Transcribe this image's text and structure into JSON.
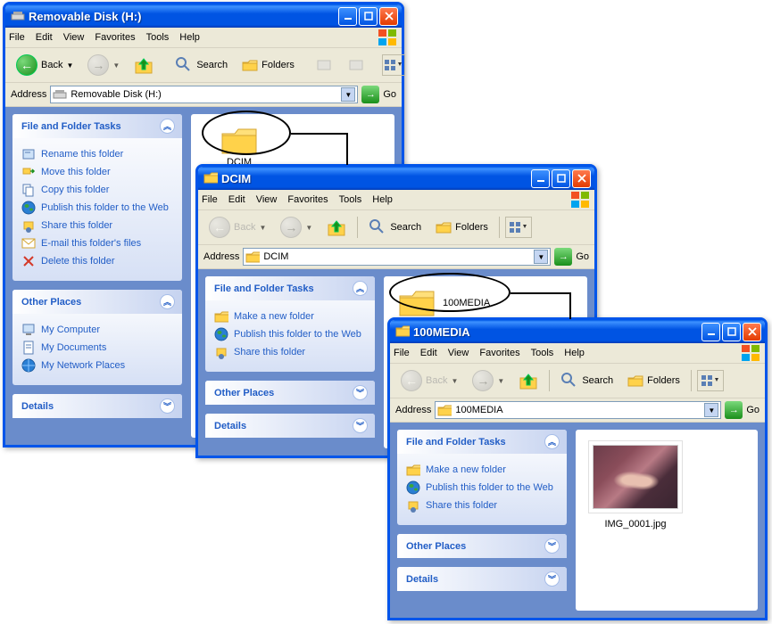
{
  "windows": {
    "w1": {
      "title": "Removable Disk (H:)",
      "menu": {
        "file": "File",
        "edit": "Edit",
        "view": "View",
        "favorites": "Favorites",
        "tools": "Tools",
        "help": "Help"
      },
      "toolbar": {
        "back": "Back",
        "search": "Search",
        "folders": "Folders"
      },
      "address_label": "Address",
      "address_value": "Removable Disk (H:)",
      "go": "Go",
      "sidebar": {
        "tasks_title": "File and Folder Tasks",
        "tasks": [
          {
            "label": "Rename this folder"
          },
          {
            "label": "Move this folder"
          },
          {
            "label": "Copy this folder"
          },
          {
            "label": "Publish this folder to the Web"
          },
          {
            "label": "Share this folder"
          },
          {
            "label": "E-mail this folder's files"
          },
          {
            "label": "Delete this folder"
          }
        ],
        "other_title": "Other Places",
        "other": [
          {
            "label": "My Computer"
          },
          {
            "label": "My Documents"
          },
          {
            "label": "My Network Places"
          }
        ],
        "details_title": "Details"
      },
      "content": {
        "folder_name": "DCIM"
      }
    },
    "w2": {
      "title": "DCIM",
      "menu": {
        "file": "File",
        "edit": "Edit",
        "view": "View",
        "favorites": "Favorites",
        "tools": "Tools",
        "help": "Help"
      },
      "toolbar": {
        "back": "Back",
        "search": "Search",
        "folders": "Folders"
      },
      "address_label": "Address",
      "address_value": "DCIM",
      "go": "Go",
      "sidebar": {
        "tasks_title": "File and Folder Tasks",
        "tasks": [
          {
            "label": "Make a new folder"
          },
          {
            "label": "Publish this folder to the Web"
          },
          {
            "label": "Share this folder"
          }
        ],
        "other_title": "Other Places",
        "details_title": "Details"
      },
      "content": {
        "folder_name": "100MEDIA"
      }
    },
    "w3": {
      "title": "100MEDIA",
      "menu": {
        "file": "File",
        "edit": "Edit",
        "view": "View",
        "favorites": "Favorites",
        "tools": "Tools",
        "help": "Help"
      },
      "toolbar": {
        "back": "Back",
        "search": "Search",
        "folders": "Folders"
      },
      "address_label": "Address",
      "address_value": "100MEDIA",
      "go": "Go",
      "sidebar": {
        "tasks_title": "File and Folder Tasks",
        "tasks": [
          {
            "label": "Make a new folder"
          },
          {
            "label": "Publish this folder to the Web"
          },
          {
            "label": "Share this folder"
          }
        ],
        "other_title": "Other Places",
        "details_title": "Details"
      },
      "content": {
        "image_name": "IMG_0001.jpg"
      }
    }
  }
}
